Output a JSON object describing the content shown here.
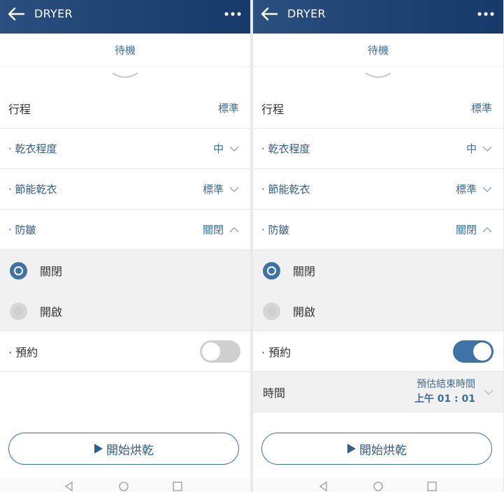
{
  "colors": {
    "topbar": "#1d4272",
    "accent": "#3f73a8",
    "text_blue": "#3a6e9e",
    "option_bg": "#f1f1f1"
  },
  "icons": [
    "back-arrow-icon",
    "more-icon",
    "chevron-down-icon",
    "chevron-up-icon",
    "play-icon",
    "nav-back-icon",
    "nav-home-icon",
    "nav-recents-icon"
  ],
  "left": {
    "header": {
      "title": "DRYER"
    },
    "status": "待機",
    "course": {
      "label": "行程",
      "value": "標準"
    },
    "dryness": {
      "label": "· 乾衣程度",
      "value": "中"
    },
    "eco": {
      "label": "· 節能乾衣",
      "value": "標準"
    },
    "wrinkle": {
      "label": "· 防皺",
      "value": "關閉"
    },
    "wrinkle_options": [
      {
        "label": "關閉",
        "selected": true
      },
      {
        "label": "開啟",
        "selected": false
      }
    ],
    "reserve": {
      "label": "· 預約",
      "enabled": false
    },
    "start_button": "開始烘乾"
  },
  "right": {
    "header": {
      "title": "DRYER"
    },
    "status": "待機",
    "course": {
      "label": "行程",
      "value": "標準"
    },
    "dryness": {
      "label": "· 乾衣程度",
      "value": "中"
    },
    "eco": {
      "label": "· 節能乾衣",
      "value": "標準"
    },
    "wrinkle": {
      "label": "· 防皺",
      "value": "關閉"
    },
    "wrinkle_options": [
      {
        "label": "關閉",
        "selected": true
      },
      {
        "label": "開啟",
        "selected": false
      }
    ],
    "reserve": {
      "label": "· 預約",
      "enabled": true
    },
    "time": {
      "label": "時間",
      "line1": "預估結束時間",
      "line2": "上午 01 : 01"
    },
    "start_button": "開始烘乾"
  }
}
